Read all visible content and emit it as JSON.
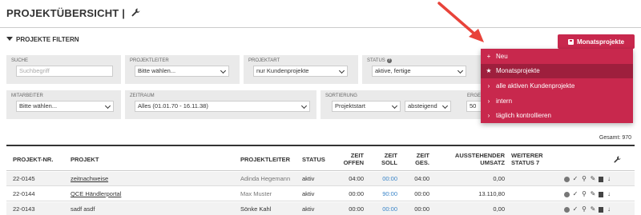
{
  "page": {
    "title": "PROJEKTÜBERSICHT |"
  },
  "filter": {
    "toggle_label": "PROJEKTE FILTERN"
  },
  "monats_button": {
    "label": "Monatsprojekte"
  },
  "fields": {
    "suche": {
      "label": "SUCHE",
      "placeholder": "Suchbegriff"
    },
    "projektleiter": {
      "label": "PROJEKTLEITER",
      "value": "Bitte wählen..."
    },
    "projektart": {
      "label": "PROJEKTART",
      "value": "nur Kundenprojekte"
    },
    "status": {
      "label": "STATUS",
      "value": "aktive, fertige"
    },
    "mitarbeiter": {
      "label": "MITARBEITER",
      "value": "Bitte wählen..."
    },
    "zeitraum": {
      "label": "ZEITRAUM",
      "value": "Alles (01.01.70 - 16.11.38)"
    },
    "sortierung": {
      "label": "SORTIERUNG",
      "value": "Projektstart",
      "direction": "absteigend"
    },
    "ergebnisse": {
      "label": "ERGEB",
      "value": "50"
    }
  },
  "dropdown": {
    "items": [
      {
        "icon": "+",
        "label": "Neu",
        "active": false
      },
      {
        "icon": "★",
        "label": "Monatsprojekte",
        "active": true
      },
      {
        "icon": "›",
        "label": "alle aktiven Kundenprojekte",
        "active": false
      },
      {
        "icon": "›",
        "label": "intern",
        "active": false
      },
      {
        "icon": "›",
        "label": "täglich kontrollieren",
        "active": false
      }
    ]
  },
  "table": {
    "total": "Gesamt: 970",
    "headers": {
      "nr": "PROJEKT-NR.",
      "projekt": "PROJEKT",
      "leiter": "PROJEKTLEITER",
      "status": "STATUS",
      "offen_1": "ZEIT",
      "offen_2": "OFFEN",
      "soll_1": "ZEIT",
      "soll_2": "SOLL",
      "ges_1": "ZEIT",
      "ges_2": "GES.",
      "umsatz_1": "AUSSTEHENDER",
      "umsatz_2": "UMSATZ",
      "weiterer_1": "WEITERER",
      "weiterer_2": "STATUS 7"
    },
    "rows": [
      {
        "nr": "22-0145",
        "projekt": "zeitnachweise",
        "leiter": "Adinda Hegemann",
        "status": "aktiv",
        "offen": "04:00",
        "soll": "00:00",
        "ges": "04:00",
        "umsatz": "0,00"
      },
      {
        "nr": "22-0144",
        "projekt": "QCE Händlerportal",
        "leiter": "Max Muster",
        "status": "aktiv",
        "offen": "00:00",
        "soll": "90:00",
        "ges": "00:00",
        "umsatz": "13.110,80"
      },
      {
        "nr": "22-0143",
        "projekt": "sadf asdf",
        "leiter": "Sönke Kahl",
        "status": "aktiv",
        "offen": "00:00",
        "soll": "00:00",
        "ges": "00:00",
        "umsatz": "0,00"
      }
    ]
  },
  "colors": {
    "accent": "#c8284d",
    "accent_dark": "#9e1f3d",
    "arrow": "#e8433a",
    "link_blue": "#3a85c8"
  }
}
